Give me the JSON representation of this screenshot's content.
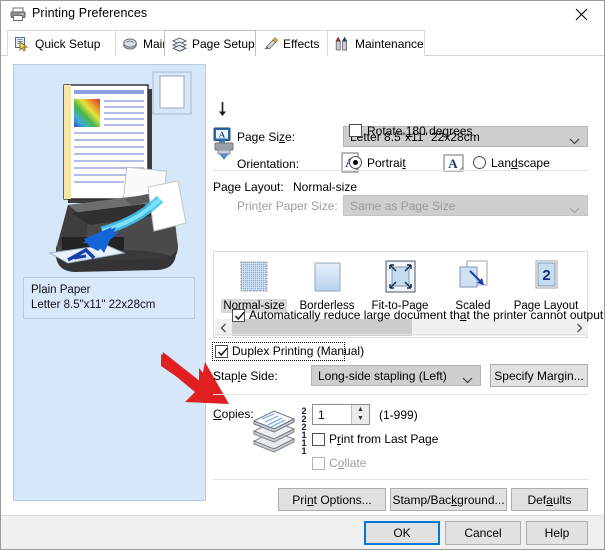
{
  "window": {
    "title": "Printing Preferences",
    "icon": "printer-icon",
    "close_label": "✕"
  },
  "tabs": [
    {
      "label": "Quick Setup",
      "icon": "quick-setup-icon",
      "active": false
    },
    {
      "label": "Main",
      "icon": "main-icon",
      "active": false
    },
    {
      "label": "Page Setup",
      "icon": "page-setup-icon",
      "active": true
    },
    {
      "label": "Effects",
      "icon": "effects-icon",
      "active": false
    },
    {
      "label": "Maintenance",
      "icon": "maintenance-icon",
      "active": false
    }
  ],
  "preview": {
    "paper_type": "Plain Paper",
    "paper_size": "Letter 8.5\"x11\" 22x28cm",
    "document_icon": "document-preview-icon",
    "printer_icon": "printer-illustration-icon",
    "annotation_arrow": "red-pointer-arrow"
  },
  "page_size": {
    "label": "Page Size:",
    "icon": "page-size-monitor-icon",
    "value": "Letter 8.5\"x11\" 22x28cm"
  },
  "orientation": {
    "label": "Orientation:",
    "icon": "orientation-arrow-icon",
    "portrait_label": "Portrait",
    "portrait_icon": "portrait-page-icon",
    "portrait_selected": true,
    "landscape_label": "Landscape",
    "landscape_icon": "landscape-page-icon",
    "landscape_selected": false,
    "rotate_label": "Rotate 180 degrees",
    "rotate_checked": false
  },
  "printer_paper_size": {
    "label": "Printer Paper Size:",
    "icon": "printer-paper-size-icon",
    "value": "Same as Page Size",
    "disabled": true
  },
  "page_layout": {
    "label": "Page Layout:",
    "value": "Normal-size",
    "items": [
      {
        "name": "Normal-size",
        "icon": "normal-size-icon",
        "selected": true
      },
      {
        "name": "Borderless",
        "icon": "borderless-icon",
        "selected": false
      },
      {
        "name": "Fit-to-Page",
        "icon": "fit-to-page-icon",
        "selected": false
      },
      {
        "name": "Scaled",
        "icon": "scaled-icon",
        "selected": false
      },
      {
        "name": "Page Layout",
        "icon": "page-layout-icon",
        "selected": false
      }
    ],
    "scroll_left_icon": "chevron-left-icon",
    "scroll_right_icon": "chevron-right-icon"
  },
  "auto_reduce": {
    "label": "Automatically reduce large document that the printer cannot output",
    "checked": true
  },
  "duplex": {
    "label": "Duplex Printing (Manual)",
    "checked": true,
    "focused": true
  },
  "staple": {
    "label": "Staple Side:",
    "value": "Long-side stapling (Left)",
    "margin_button": "Specify Margin..."
  },
  "copies": {
    "label": "Copies:",
    "icon": "copies-stack-icon",
    "value": "1",
    "range": "(1-999)",
    "print_last_page_label": "Print from Last Page",
    "print_last_page_checked": false,
    "collate_label": "Collate",
    "collate_checked": false,
    "collate_disabled": true
  },
  "action_buttons": {
    "print_options": "Print Options...",
    "stamp_background": "Stamp/Background...",
    "defaults": "Defaults"
  },
  "footer_buttons": {
    "ok": "OK",
    "cancel": "Cancel",
    "help": "Help"
  },
  "colors": {
    "accent": "#0078d7",
    "panel": "#d7e7fa",
    "arrow_red": "#e02020",
    "window_bg": "#f0f0f0"
  }
}
